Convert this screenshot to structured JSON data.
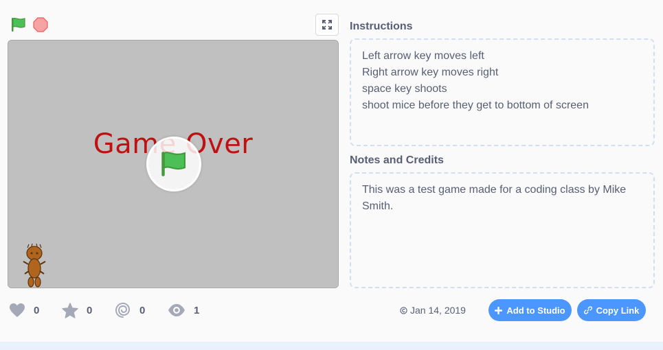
{
  "stage": {
    "overlay_text": "Game Over"
  },
  "instructions": {
    "heading": "Instructions",
    "lines": [
      "Left arrow key moves left",
      "Right arrow key moves right",
      "space key shoots",
      "shoot mice before they get to bottom of screen"
    ]
  },
  "notes": {
    "heading": "Notes and Credits",
    "lines": [
      "This was a test game made for a coding class by Mike",
      "Smith."
    ]
  },
  "stats": {
    "loves": "0",
    "favorites": "0",
    "remixes": "0",
    "views": "1"
  },
  "shared": {
    "date": "Jan 14, 2019"
  },
  "buttons": {
    "add_to_studio": "Add to Studio",
    "copy_link": "Copy Link"
  },
  "colors": {
    "accent": "#4c97ff",
    "game_over": "#bf1111",
    "flag_green": "#4cbf56",
    "stop_red": "#ec5959"
  },
  "icons": {
    "green_flag": "green-flag-icon",
    "stop": "stop-icon",
    "fullscreen": "fullscreen-icon",
    "love": "heart-icon",
    "favorite": "star-icon",
    "remix": "remix-icon",
    "views": "eye-icon",
    "date": "copyright-icon",
    "add": "plus-icon",
    "link": "link-icon"
  }
}
